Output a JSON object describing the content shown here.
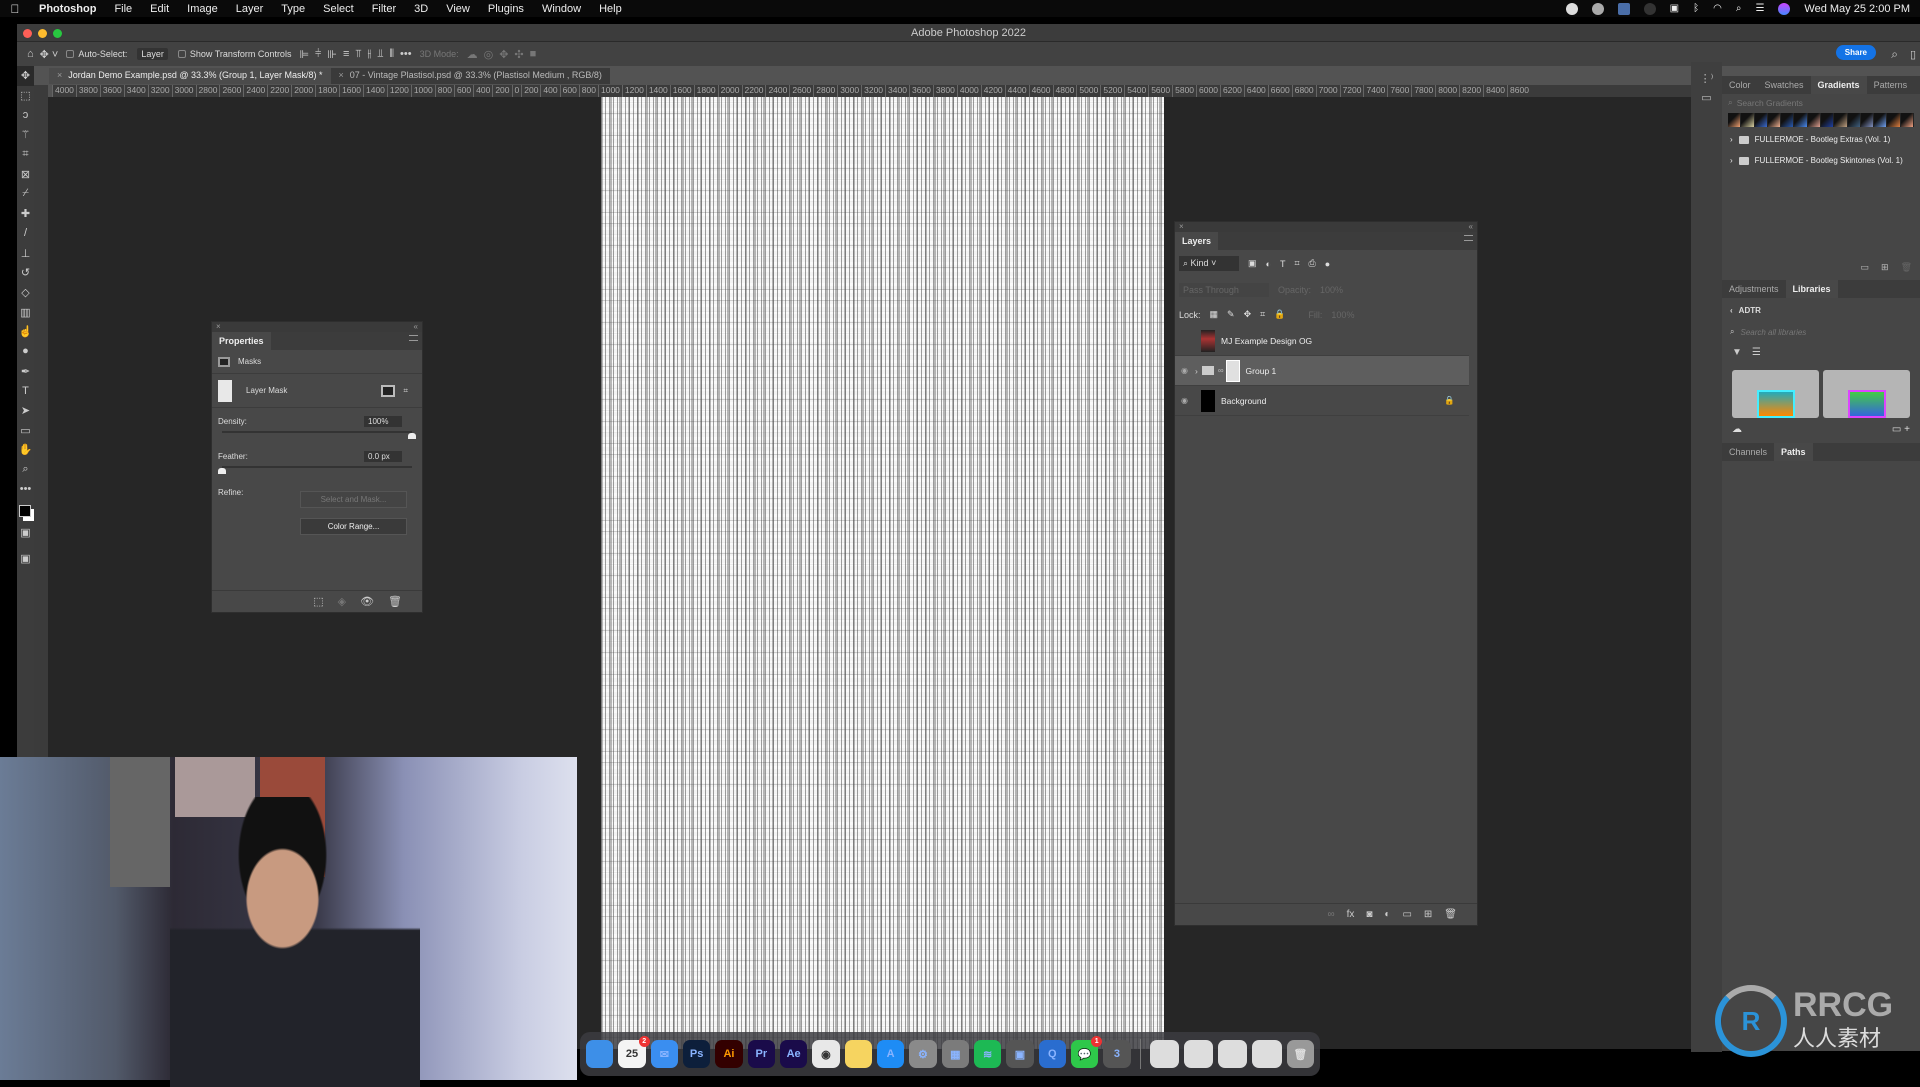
{
  "menubar": {
    "app_name": "Photoshop",
    "items": [
      "File",
      "Edit",
      "Image",
      "Layer",
      "Type",
      "Select",
      "Filter",
      "3D",
      "View",
      "Plugins",
      "Window",
      "Help"
    ],
    "clock": "Wed May 25  2:00 PM"
  },
  "window": {
    "title": "Adobe Photoshop 2022"
  },
  "options_bar": {
    "auto_select_label": "Auto-Select:",
    "auto_select_value": "Layer",
    "show_transform_label": "Show Transform Controls",
    "mode_3d_label": "3D Mode:",
    "share_label": "Share"
  },
  "doc_tabs": [
    {
      "label": "Jordan Demo Example.psd @ 33.3% (Group 1, Layer Mask/8) *",
      "active": true
    },
    {
      "label": "07 - Vintage Plastisol.psd @ 33.3% (Plastisol Medium , RGB/8)",
      "active": false
    }
  ],
  "ruler_top": [
    "4000",
    "3800",
    "3600",
    "3400",
    "3200",
    "3000",
    "2800",
    "2600",
    "2400",
    "2200",
    "2000",
    "1800",
    "1600",
    "1400",
    "1200",
    "1000",
    "800",
    "600",
    "400",
    "200",
    "0",
    "200",
    "400",
    "600",
    "800",
    "1000",
    "1200",
    "1400",
    "1600",
    "1800",
    "2000",
    "2200",
    "2400",
    "2600",
    "2800",
    "3000",
    "3200",
    "3400",
    "3600",
    "3800",
    "4000",
    "4200",
    "4400",
    "4600",
    "4800",
    "5000",
    "5200",
    "5400",
    "5600",
    "5800",
    "6000",
    "6200",
    "6400",
    "6600",
    "6800",
    "7000",
    "7200",
    "7400",
    "7600",
    "7800",
    "8000",
    "8200",
    "8400",
    "8600"
  ],
  "tools": [
    "move",
    "rectangular-marquee",
    "lasso",
    "magic-wand",
    "crop",
    "frame",
    "eyedropper",
    "healing-brush",
    "brush",
    "clone-stamp",
    "history-brush",
    "eraser",
    "gradient",
    "smudge",
    "dodge",
    "pen",
    "type",
    "path-selection",
    "rectangle",
    "hand",
    "zoom",
    "more-tools"
  ],
  "properties": {
    "tab": "Properties",
    "section": "Masks",
    "mask_label": "Layer Mask",
    "density_label": "Density:",
    "density_value": "100%",
    "density_fraction": 1.0,
    "feather_label": "Feather:",
    "feather_value": "0.0 px",
    "feather_fraction": 0.0,
    "refine_label": "Refine:",
    "select_and_mask": "Select and Mask...",
    "color_range": "Color Range..."
  },
  "layers": {
    "tab": "Layers",
    "filter_kind": "Kind",
    "blend_mode": "Pass Through",
    "opacity_label": "Opacity:",
    "opacity_value": "100%",
    "lock_label": "Lock:",
    "fill_label": "Fill:",
    "fill_value": "100%",
    "rows": [
      {
        "name": "MJ Example Design OG",
        "visible": false,
        "selected": false
      },
      {
        "name": "Group 1",
        "visible": true,
        "selected": true
      },
      {
        "name": "Background",
        "visible": true,
        "selected": false,
        "locked": true
      }
    ]
  },
  "right_panels": {
    "top_tabs": [
      "Color",
      "Swatches",
      "Gradients",
      "Patterns"
    ],
    "active_top_tab": "Gradients",
    "search_placeholder": "Search Gradients",
    "gradient_folders": [
      "FULLERMOE - Bootleg Extras (Vol. 1)",
      "FULLERMOE - Bootleg Skintones (Vol. 1)"
    ],
    "mid_tabs": [
      "Adjustments",
      "Libraries"
    ],
    "active_mid_tab": "Libraries",
    "library_name": "ADTR",
    "library_search_placeholder": "Search all libraries",
    "bottom_tabs": [
      "Channels",
      "Paths"
    ],
    "active_bottom_tab": "Paths"
  },
  "dock": {
    "apps": [
      {
        "name": "Finder",
        "label": "",
        "color": "#3d8fe8"
      },
      {
        "name": "Calendar",
        "label": "25",
        "color": "#f4f4f4",
        "badge": "2"
      },
      {
        "name": "Mail",
        "label": "✉",
        "color": "#3a8ef0"
      },
      {
        "name": "Photoshop",
        "label": "Ps",
        "color": "#0d1f3b"
      },
      {
        "name": "Illustrator",
        "label": "Ai",
        "color": "#330000"
      },
      {
        "name": "Premiere Pro",
        "label": "Pr",
        "color": "#1a0b4a"
      },
      {
        "name": "After Effects",
        "label": "Ae",
        "color": "#1a0b4a"
      },
      {
        "name": "Chrome",
        "label": "◉",
        "color": "#e8e8e8"
      },
      {
        "name": "Notes",
        "label": "",
        "color": "#f6d460"
      },
      {
        "name": "App Store",
        "label": "A",
        "color": "#1e8cf5"
      },
      {
        "name": "System Preferences",
        "label": "⚙",
        "color": "#8a8a8a"
      },
      {
        "name": "Launchpad",
        "label": "▦",
        "color": "#7b7b7b"
      },
      {
        "name": "Spotify",
        "label": "≋",
        "color": "#1db954"
      },
      {
        "name": "Screen Sharing",
        "label": "▣",
        "color": "#555"
      },
      {
        "name": "QuickTime",
        "label": "Q",
        "color": "#2a6dcf"
      },
      {
        "name": "Messages",
        "label": "💬",
        "color": "#2ec84a",
        "badge": "1"
      },
      {
        "name": "Screen Sharing 2",
        "label": "3",
        "color": "#555"
      }
    ],
    "windows": [
      "window-1",
      "window-2",
      "window-3",
      "window-4"
    ]
  },
  "watermark": {
    "brand": "RRCG",
    "sub": "人人素材"
  },
  "colors": {
    "accent": "#1473e6",
    "panel": "#484848",
    "canvas_bg": "#262626"
  }
}
